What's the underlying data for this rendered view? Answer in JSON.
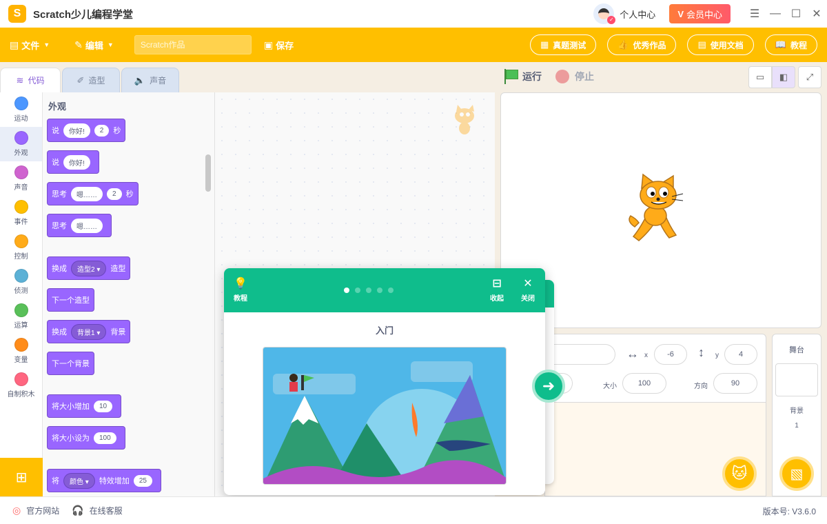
{
  "app": {
    "title": "Scratch少儿编程学堂",
    "logo_glyph": "S"
  },
  "titlebar": {
    "user_label": "个人中心",
    "vip_label": "会员中心",
    "vip_mark": "V"
  },
  "menu": {
    "file": "文件",
    "edit": "编辑",
    "project_placeholder": "Scratch作品",
    "save": "保存",
    "right": [
      "真题测试",
      "优秀作品",
      "使用文档",
      "教程"
    ]
  },
  "tabs": [
    "代码",
    "造型",
    "声音"
  ],
  "categories": [
    {
      "label": "运动",
      "color": "#4c97ff"
    },
    {
      "label": "外观",
      "color": "#9966ff"
    },
    {
      "label": "声音",
      "color": "#cf63cf"
    },
    {
      "label": "事件",
      "color": "#ffbf00"
    },
    {
      "label": "控制",
      "color": "#ffab19"
    },
    {
      "label": "侦测",
      "color": "#5cb1d6"
    },
    {
      "label": "运算",
      "color": "#59c059"
    },
    {
      "label": "变量",
      "color": "#ff8c1a"
    },
    {
      "label": "自制积木",
      "color": "#ff6680"
    }
  ],
  "palette": {
    "section": "外观",
    "say_secs": {
      "a": "说",
      "msg": "你好!",
      "n": "2",
      "unit": "秒"
    },
    "say": {
      "a": "说",
      "msg": "你好!"
    },
    "think_secs": {
      "a": "思考",
      "msg": "嗯……",
      "n": "2",
      "unit": "秒"
    },
    "think": {
      "a": "思考",
      "msg": "嗯……"
    },
    "switch_costume": {
      "a": "换成",
      "opt": "造型2",
      "b": "造型"
    },
    "next_costume": "下一个造型",
    "switch_backdrop": {
      "a": "换成",
      "opt": "背景1",
      "b": "背景"
    },
    "next_backdrop": "下一个背景",
    "change_size": {
      "a": "将大小增加",
      "n": "10"
    },
    "set_size": {
      "a": "将大小设为",
      "n": "100"
    },
    "change_effect": {
      "a": "将",
      "opt": "颜色",
      "b": "特效增加",
      "n": "25"
    }
  },
  "stage_ctl": {
    "run": "运行",
    "stop": "停止"
  },
  "sprite_info": {
    "x_label": "x",
    "x": "-6",
    "y_label": "y",
    "y": "4",
    "size_label": "大小",
    "size": "100",
    "dir_label": "方向",
    "dir": "90"
  },
  "stage_panel": {
    "title": "舞台",
    "backdrop_label": "背景",
    "backdrop_count": "1"
  },
  "tutorial": {
    "icon_label": "教程",
    "collapse": "收起",
    "close": "关闭",
    "title": "入门",
    "pages": 5,
    "current": 1
  },
  "status": {
    "site": "官方网站",
    "support": "在线客服",
    "version": "版本号: V3.6.0"
  },
  "colors": {
    "brand": "#ffbf00",
    "looks": "#9966ff",
    "tutorial": "#0fbd8c"
  }
}
